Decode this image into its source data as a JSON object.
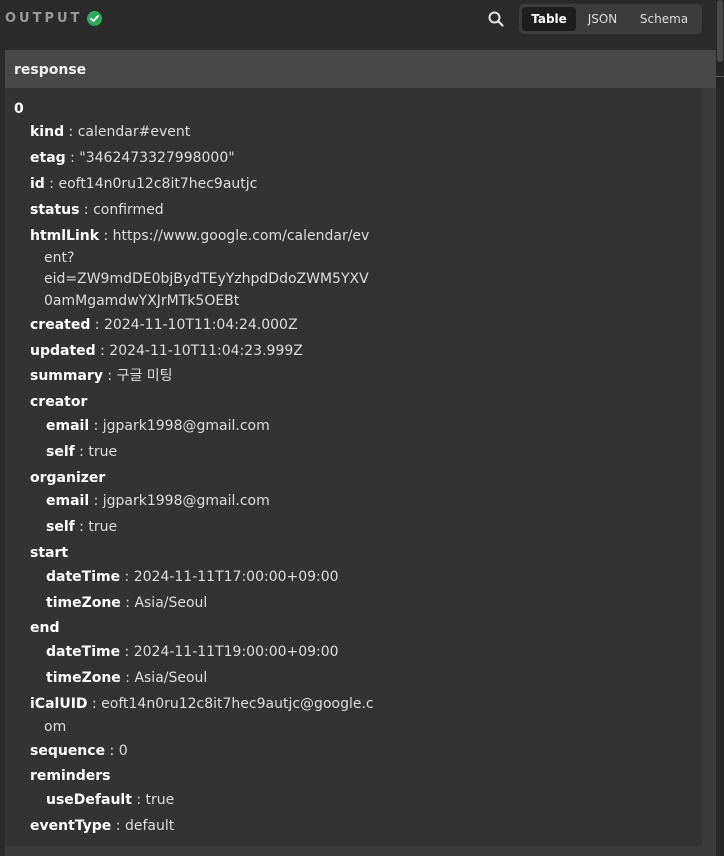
{
  "header": {
    "title": "OUTPUT",
    "status_icon": "check-circle-icon",
    "search_icon": "search-icon",
    "tabs": [
      "Table",
      "JSON",
      "Schema"
    ],
    "active_tab": "Table"
  },
  "colors": {
    "success": "#2fa85e",
    "panel_bg": "#333333",
    "header_bg": "#484848"
  },
  "panel": {
    "title": "response"
  },
  "tree": {
    "index": "0",
    "kind": {
      "key": "kind",
      "value": "calendar#event"
    },
    "etag": {
      "key": "etag",
      "value": "\"3462473327998000\""
    },
    "id": {
      "key": "id",
      "value": "eoft14n0ru12c8it7hec9autjc"
    },
    "status": {
      "key": "status",
      "value": "confirmed"
    },
    "htmlLink": {
      "key": "htmlLink",
      "lines": [
        "https://www.google.com/calendar/ev",
        "ent?",
        "eid=ZW9mdDE0bjBydTEyYzhpdDdoZWM5YXV",
        "0amMgamdwYXJrMTk5OEBt"
      ]
    },
    "created": {
      "key": "created",
      "value": "2024-11-10T11:04:24.000Z"
    },
    "updated": {
      "key": "updated",
      "value": "2024-11-10T11:04:23.999Z"
    },
    "summary": {
      "key": "summary",
      "value": "구글 미팅"
    },
    "creator": {
      "key": "creator",
      "email": {
        "key": "email",
        "value": "jgpark1998@gmail.com"
      },
      "self": {
        "key": "self",
        "value": "true"
      }
    },
    "organizer": {
      "key": "organizer",
      "email": {
        "key": "email",
        "value": "jgpark1998@gmail.com"
      },
      "self": {
        "key": "self",
        "value": "true"
      }
    },
    "start": {
      "key": "start",
      "dateTime": {
        "key": "dateTime",
        "value": "2024-11-11T17:00:00+09:00"
      },
      "timeZone": {
        "key": "timeZone",
        "value": "Asia/Seoul"
      }
    },
    "end": {
      "key": "end",
      "dateTime": {
        "key": "dateTime",
        "value": "2024-11-11T19:00:00+09:00"
      },
      "timeZone": {
        "key": "timeZone",
        "value": "Asia/Seoul"
      }
    },
    "iCalUID": {
      "key": "iCalUID",
      "lines": [
        "eoft14n0ru12c8it7hec9autjc@google.c",
        "om"
      ]
    },
    "sequence": {
      "key": "sequence",
      "value": "0"
    },
    "reminders": {
      "key": "reminders",
      "useDefault": {
        "key": "useDefault",
        "value": "true"
      }
    },
    "eventType": {
      "key": "eventType",
      "value": "default"
    }
  }
}
